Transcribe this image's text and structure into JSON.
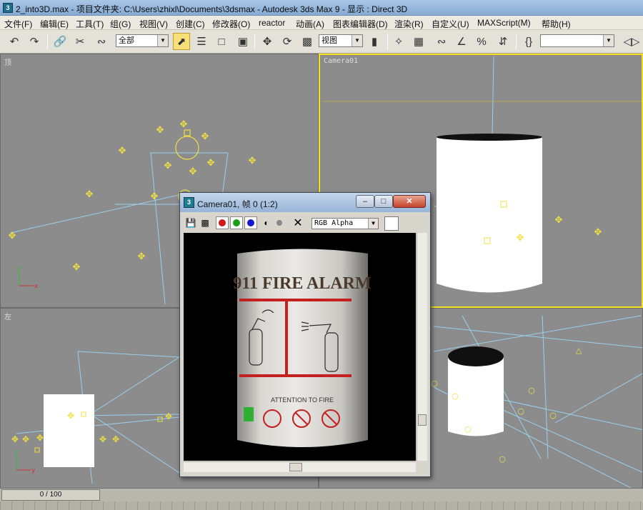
{
  "window": {
    "title": "2_into3D.max    - 项目文件夹: C:\\Users\\zhixl\\Documents\\3dsmax    - Autodesk 3ds Max 9    - 显示 : Direct 3D",
    "icon": "3ds-max-icon"
  },
  "menu": [
    "文件(F)",
    "编辑(E)",
    "工具(T)",
    "组(G)",
    "视图(V)",
    "创建(C)",
    "修改器(O)",
    "reactor",
    "动画(A)",
    "图表编辑器(D)",
    "渲染(R)",
    "自定义(U)",
    "MAXScript(M)",
    "帮助(H)"
  ],
  "toolbar": {
    "selection_filter": "全部",
    "coord_system": "视图",
    "named_selection": ""
  },
  "viewports": {
    "top": {
      "label": "顶"
    },
    "camera": {
      "label": "Camera01"
    },
    "left": {
      "label": "左"
    },
    "perspective": {
      "label": ""
    }
  },
  "render_window": {
    "title": "Camera01, 帧 0 (1:2)",
    "channel": "RGB Alpha",
    "channel_colors": [
      "#d01818",
      "#18a018",
      "#1818d0"
    ],
    "label_title": "911 FIRE ALARM",
    "label_subtitle": "ATTENTION TO FIRE"
  },
  "timeline": {
    "frame_display": "0 / 100"
  }
}
